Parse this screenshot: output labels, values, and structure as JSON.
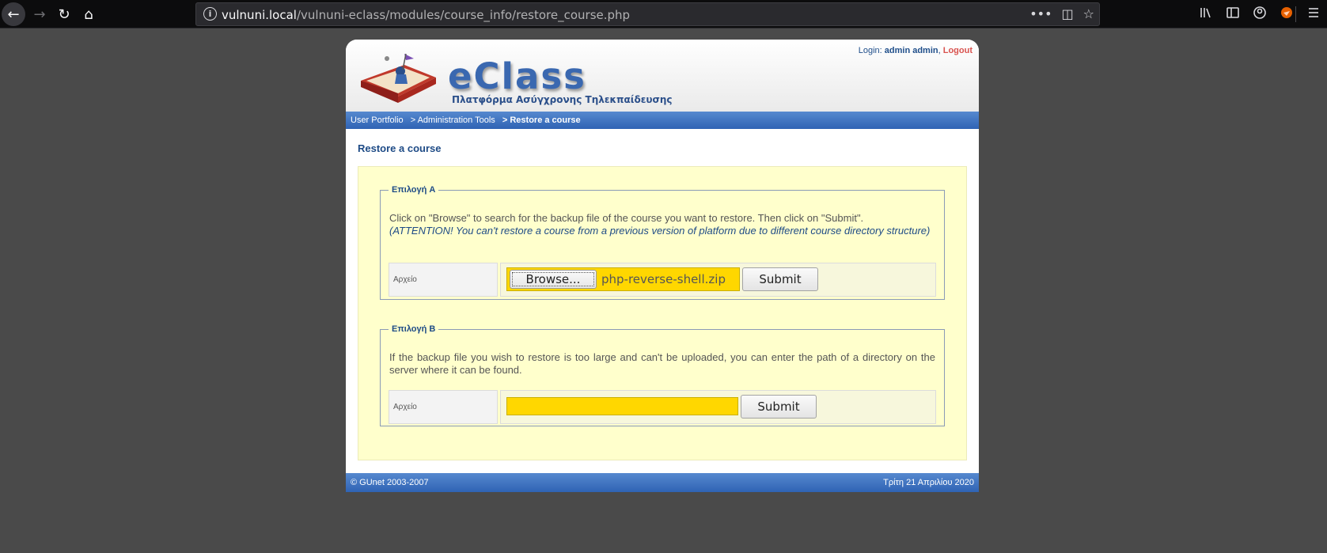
{
  "browser": {
    "url_domain": "vulnuni.local",
    "url_path": "/vulnuni-eclass/modules/course_info/restore_course.php",
    "info_glyph": "i",
    "url_actions": [
      "•••",
      "◫",
      "☆"
    ],
    "toolbar_icons": [
      "library-icon",
      "sidebar-icon",
      "account-icon",
      "extension-icon",
      "menu-icon"
    ]
  },
  "header": {
    "title": "eClass",
    "subtitle": "Πλατφόρμα Ασύγχρονης Τηλεκπαίδευσης",
    "login_label": "Login:",
    "login_user": "admin admin",
    "login_sep": ",",
    "logout": "Logout"
  },
  "breadcrumb": {
    "items": [
      "User Portfolio",
      "> Administration Tools",
      "> Restore a course"
    ]
  },
  "page_title": "Restore a course",
  "option_a": {
    "legend": "Επιλογή A",
    "description": "Click on \"Browse\" to search for the backup file of the course you want to restore. Then click on \"Submit\".",
    "attention": "(ATTENTION! You can't restore a course from a previous version of platform due to different course directory structure)",
    "field_label": "Αρχείο",
    "browse_label": "Browse...",
    "file_name": "php-reverse-shell.zip",
    "submit_label": "Submit"
  },
  "option_b": {
    "legend": "Επιλογή B",
    "description": "If the backup file you wish to restore is too large and can't be uploaded, you can enter the path of a directory on the server where it can be found.",
    "field_label": "Αρχείο",
    "path_value": "",
    "submit_label": "Submit"
  },
  "footer": {
    "left": "© GUnet 2003-2007",
    "right": "Τρίτη 21 Απριλίου 2020"
  },
  "colors": {
    "accent_blue": "#2f63b4",
    "content_bg": "#ffffcc",
    "input_highlight": "#ffd700"
  }
}
